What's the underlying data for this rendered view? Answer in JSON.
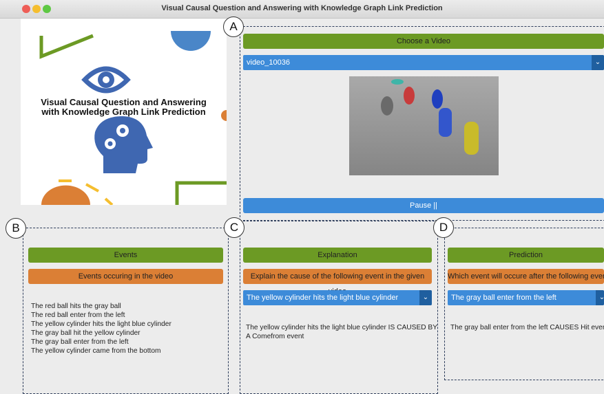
{
  "window": {
    "title": "Visual Causal Question and Answering with Knowledge Graph Link Prediction"
  },
  "logo": {
    "line1": "Visual Causal Question and Answering",
    "line2": "with Knowledge Graph Link Prediction"
  },
  "labels": {
    "a": "A",
    "b": "B",
    "c": "C",
    "d": "D"
  },
  "video_panel": {
    "header": "Choose a Video",
    "selected_video": "video_10036",
    "pause_label": "Pause ||"
  },
  "events_panel": {
    "header": "Events",
    "subheader": "Events occuring in the video",
    "events": [
      "The red ball hits the gray ball",
      "The red ball enter from the left",
      "The yellow cylinder hits the light blue cylinder",
      "The gray ball hit the yellow cylinder",
      "The gray ball enter from the left",
      "The yellow cylinder came from the bottom"
    ]
  },
  "explanation_panel": {
    "header": "Explanation",
    "subheader": "Explain the cause of the following event in the given video",
    "selected_event": "The yellow cylinder hits the light blue cylinder",
    "answer_line1": "The yellow cylinder hits the light blue cylinder IS CAUSED BY",
    "answer_line2": "A Comefrom event"
  },
  "prediction_panel": {
    "header": "Prediction",
    "subheader": "Which event will occure after the following event",
    "selected_event": "The gray ball enter from the left",
    "answer": "The gray ball enter from the left CAUSES Hit event"
  },
  "colors": {
    "header_green": "#6c9a24",
    "subheader_orange": "#db7f35",
    "select_blue": "#3d8bd9"
  }
}
